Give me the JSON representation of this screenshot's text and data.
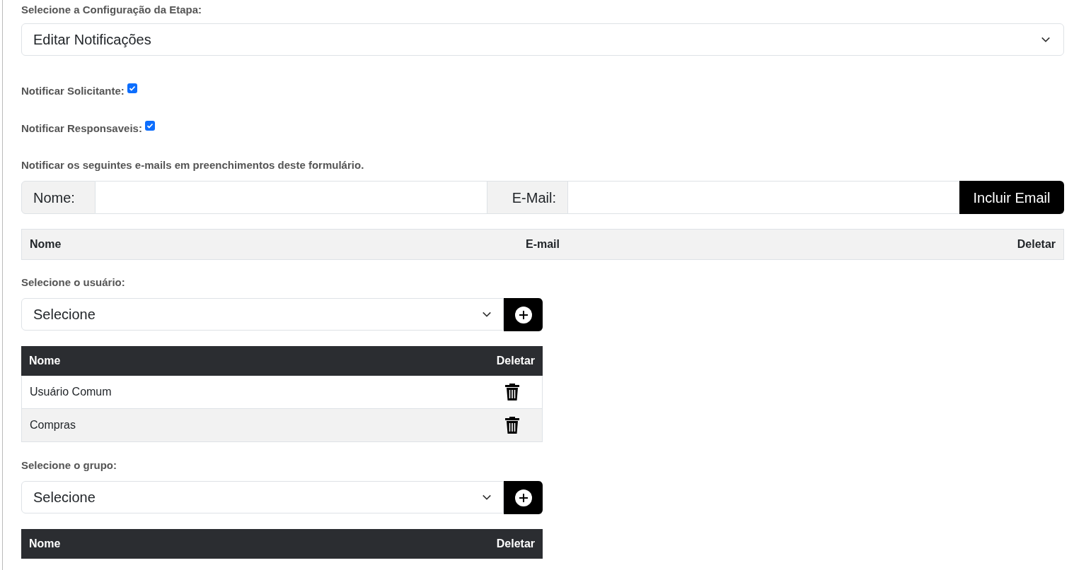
{
  "step_config": {
    "label": "Selecione a Configuração da Etapa:",
    "value": "Editar Notificações"
  },
  "notifications": [
    {
      "label": "Notificar Solicitante:",
      "checked": true
    },
    {
      "label": "Notificar Responsaveis:",
      "checked": true
    }
  ],
  "emails": {
    "caption": "Notificar os seguintes e-mails em preenchimentos deste formulário.",
    "name_label": "Nome:",
    "email_label": "E-Mail:",
    "button": "Incluir Email",
    "columns": [
      "Nome",
      "E-mail",
      "Deletar"
    ]
  },
  "users": {
    "label": "Selecione o usuário:",
    "value": "Selecione",
    "columns": [
      "Nome",
      "Deletar"
    ],
    "rows": [
      {
        "name": "Usuário Comum"
      },
      {
        "name": "Compras"
      }
    ]
  },
  "groups": {
    "label": "Selecione o grupo:",
    "value": "Selecione",
    "columns": [
      "Nome",
      "Deletar"
    ]
  }
}
